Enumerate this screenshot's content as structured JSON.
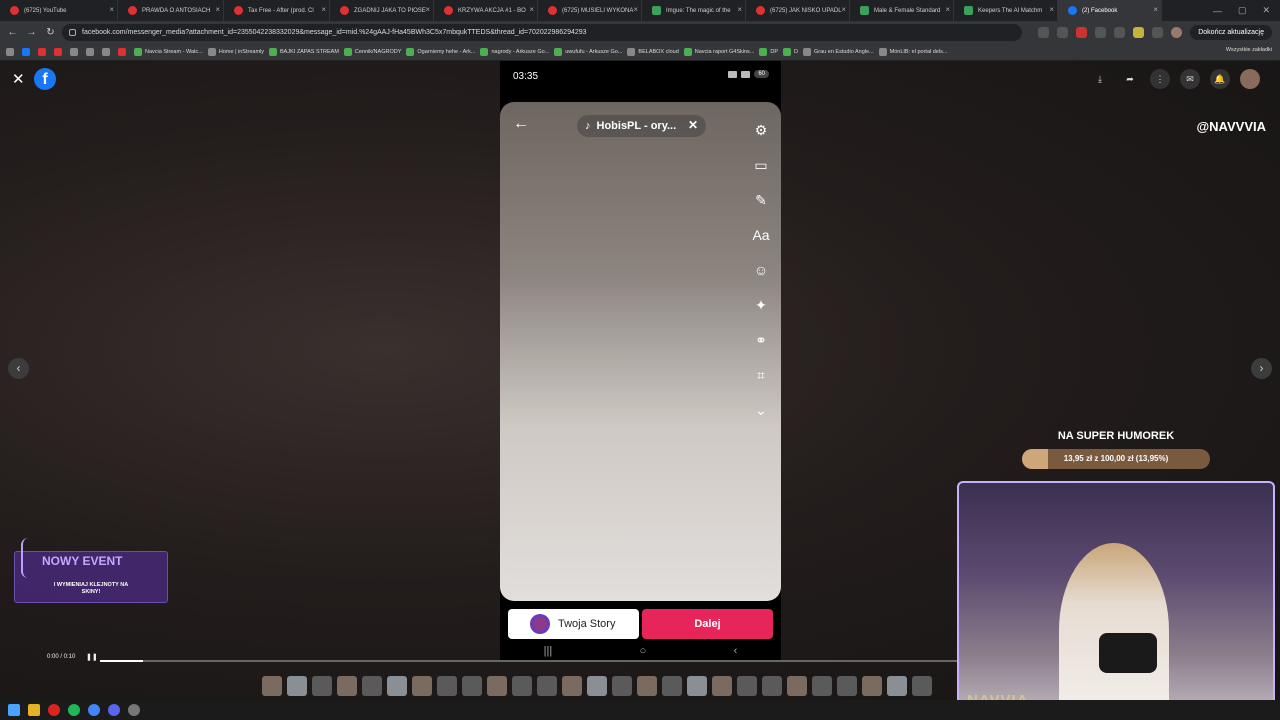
{
  "browser": {
    "tabs": [
      {
        "title": "(6725) YouTube",
        "icon": "youtube-icon"
      },
      {
        "title": "PRAWDA O ANTOSIACH",
        "icon": "youtube-icon"
      },
      {
        "title": "Tax Free - After (prod. Cl",
        "icon": "youtube-icon"
      },
      {
        "title": "ZGADNIJ JAKA TO PIOSE",
        "icon": "youtube-icon"
      },
      {
        "title": "KRZYWA AKCJA #1 - BO",
        "icon": "youtube-icon"
      },
      {
        "title": "(6725) MUSIELI WYKONA",
        "icon": "youtube-icon"
      },
      {
        "title": "Imgue: The magic of the",
        "icon": "imgur-icon"
      },
      {
        "title": "(6725) JAK NISKO UPADL",
        "icon": "youtube-icon"
      },
      {
        "title": "Male & Female Standard",
        "icon": "tab-icon"
      },
      {
        "title": "Keepers The AI Matchm",
        "icon": "tab-icon"
      },
      {
        "title": "(2) Facebook",
        "icon": "facebook-icon"
      }
    ],
    "url": "facebook.com/messenger_media?attachment_id=2355042238332029&message_id=mid.%24gAAJ-fHa45BWh3C5x7mbqukTTEDS&thread_id=702022986294293",
    "update_label": "Dokończ aktualizację",
    "bookmarks": [
      "Navcia Stream - Watc...",
      "Home | inStreamly",
      "BAJKI ZAPAS STREAM",
      "Cennik/NAGRODY",
      "Ogarniemy hehe - Ark...",
      "nagrody - Arkusze Go...",
      "uwufufu - Arkusze Go...",
      "BELABOX cloud",
      "Navcia raport G4Skins...",
      "DP",
      "D",
      "Grau en Estudio Angle...",
      "MónLIB: el portal dels..."
    ],
    "bookmarks_all": "Wszystkie zakładki"
  },
  "viewer": {
    "close_icon": "close-icon",
    "logo_letter": "f",
    "prev_arrow": "‹",
    "next_arrow": "›",
    "tiktok_handle": "@NAVVVIA"
  },
  "phone": {
    "time": "03:35",
    "battery": "60",
    "music_title": "HobisPL - ory...",
    "story_button": "Twoja Story",
    "next_button": "Dalej",
    "tools": [
      "settings-icon",
      "video-icon",
      "sticker-edit-icon",
      "text-icon",
      "sticker-icon",
      "effects-icon",
      "filters-icon",
      "crop-icon",
      "chevron-down-icon"
    ],
    "text_tool_label": "Aa"
  },
  "player": {
    "time": "0:00 / 0:10",
    "progress": 0.05
  },
  "overlay": {
    "event_title": "NOWY EVENT",
    "event_sub": "I WYMIENIAJ KLEJNOTY NA SKINY!",
    "goal_title": "NA SUPER HUMOREK",
    "goal_text": "13,95 zł z 100,00 zł (13,95%)",
    "goal_progress": 0.1395,
    "webcam_brand": "NAVVIA"
  },
  "colors": {
    "facebook_blue": "#1877f2",
    "next_button": "#e8255a",
    "goal_fill": "#cda77a",
    "event_purple": "#c7a6ff"
  }
}
